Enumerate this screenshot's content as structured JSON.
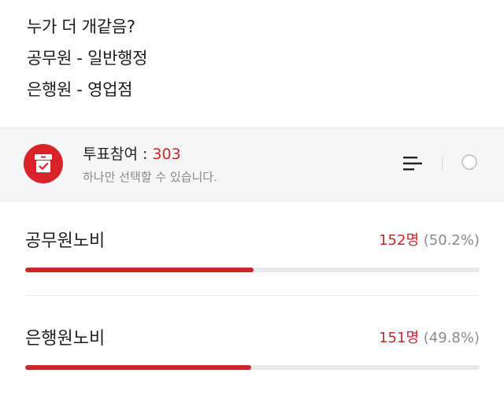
{
  "post": {
    "lines": [
      "누가 더 개같음?",
      "공무원 - 일반행정",
      "은행원 - 영업점"
    ]
  },
  "poll": {
    "title": "투표참여 : ",
    "count": "303",
    "subtitle": "하나만 선택할 수 있습니다.",
    "icon": "ballot-box-icon",
    "accent_color": "#c8282c",
    "options": [
      {
        "label": "공무원노비",
        "votes": "152명",
        "percent": "(50.2%)",
        "fraction": 0.502
      },
      {
        "label": "은행원노비",
        "votes": "151명",
        "percent": "(49.8%)",
        "fraction": 0.498
      }
    ]
  }
}
